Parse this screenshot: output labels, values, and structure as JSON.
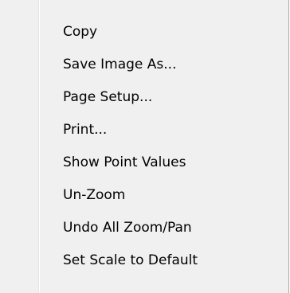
{
  "menu": {
    "items": [
      {
        "label": "Copy"
      },
      {
        "label": "Save Image As..."
      },
      {
        "label": "Page Setup..."
      },
      {
        "label": "Print..."
      },
      {
        "label": "Show Point Values"
      },
      {
        "label": "Un-Zoom"
      },
      {
        "label": "Undo All Zoom/Pan"
      },
      {
        "label": "Set Scale to Default"
      }
    ]
  },
  "colors": {
    "menu_background": "#f0f0f0",
    "gutter_separator": "#e2e3e3",
    "border": "#a8a8a8",
    "text": "#000000"
  }
}
